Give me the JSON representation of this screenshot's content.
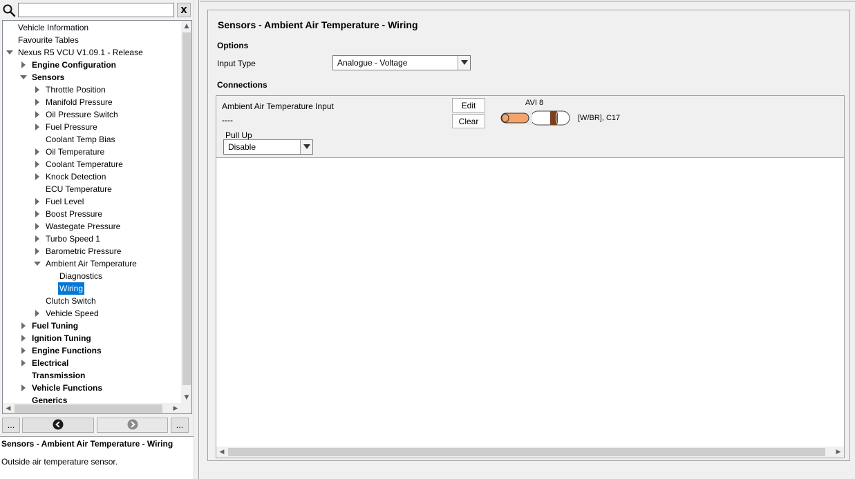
{
  "search": {
    "value": "",
    "placeholder": "",
    "clear_label": "X"
  },
  "tree": {
    "items": [
      {
        "label": "Vehicle Information",
        "depth": 0,
        "arrow": "none",
        "bold": false
      },
      {
        "label": "Favourite Tables",
        "depth": 0,
        "arrow": "none",
        "bold": false
      },
      {
        "label": "Nexus R5 VCU V1.09.1 - Release",
        "depth": 0,
        "arrow": "open",
        "bold": false
      },
      {
        "label": "Engine Configuration",
        "depth": 1,
        "arrow": "closed",
        "bold": true
      },
      {
        "label": "Sensors",
        "depth": 1,
        "arrow": "open",
        "bold": true
      },
      {
        "label": "Throttle Position",
        "depth": 2,
        "arrow": "closed",
        "bold": false
      },
      {
        "label": "Manifold Pressure",
        "depth": 2,
        "arrow": "closed",
        "bold": false
      },
      {
        "label": "Oil Pressure Switch",
        "depth": 2,
        "arrow": "closed",
        "bold": false
      },
      {
        "label": "Fuel Pressure",
        "depth": 2,
        "arrow": "closed",
        "bold": false
      },
      {
        "label": "Coolant Temp Bias",
        "depth": 2,
        "arrow": "none",
        "bold": false
      },
      {
        "label": "Oil Temperature",
        "depth": 2,
        "arrow": "closed",
        "bold": false
      },
      {
        "label": "Coolant Temperature",
        "depth": 2,
        "arrow": "closed",
        "bold": false
      },
      {
        "label": "Knock Detection",
        "depth": 2,
        "arrow": "closed",
        "bold": false
      },
      {
        "label": "ECU Temperature",
        "depth": 2,
        "arrow": "none",
        "bold": false
      },
      {
        "label": "Fuel Level",
        "depth": 2,
        "arrow": "closed",
        "bold": false
      },
      {
        "label": "Boost Pressure",
        "depth": 2,
        "arrow": "closed",
        "bold": false
      },
      {
        "label": "Wastegate Pressure",
        "depth": 2,
        "arrow": "closed",
        "bold": false
      },
      {
        "label": "Turbo Speed 1",
        "depth": 2,
        "arrow": "closed",
        "bold": false
      },
      {
        "label": "Barometric Pressure",
        "depth": 2,
        "arrow": "closed",
        "bold": false
      },
      {
        "label": "Ambient Air Temperature",
        "depth": 2,
        "arrow": "open",
        "bold": false
      },
      {
        "label": "Diagnostics",
        "depth": 3,
        "arrow": "none",
        "bold": false
      },
      {
        "label": "Wiring",
        "depth": 3,
        "arrow": "none",
        "bold": false,
        "selected": true
      },
      {
        "label": "Clutch Switch",
        "depth": 2,
        "arrow": "none",
        "bold": false
      },
      {
        "label": "Vehicle Speed",
        "depth": 2,
        "arrow": "closed",
        "bold": false
      },
      {
        "label": "Fuel Tuning",
        "depth": 1,
        "arrow": "closed",
        "bold": true
      },
      {
        "label": "Ignition Tuning",
        "depth": 1,
        "arrow": "closed",
        "bold": true
      },
      {
        "label": "Engine Functions",
        "depth": 1,
        "arrow": "closed",
        "bold": true
      },
      {
        "label": "Electrical",
        "depth": 1,
        "arrow": "closed",
        "bold": true
      },
      {
        "label": "Transmission",
        "depth": 1,
        "arrow": "none",
        "bold": true
      },
      {
        "label": "Vehicle Functions",
        "depth": 1,
        "arrow": "closed",
        "bold": true
      },
      {
        "label": "Generics",
        "depth": 1,
        "arrow": "none",
        "bold": true
      }
    ]
  },
  "nav": {
    "more_left_label": "...",
    "more_right_label": "...",
    "back_icon": "back-arrow-icon",
    "forward_icon": "forward-arrow-icon"
  },
  "description": {
    "title": "Sensors - Ambient Air Temperature - Wiring",
    "text": "Outside air temperature sensor."
  },
  "page": {
    "title": "Sensors - Ambient Air Temperature - Wiring",
    "options_heading": "Options",
    "input_type_label": "Input Type",
    "input_type_value": "Analogue - Voltage",
    "connections_heading": "Connections"
  },
  "connection": {
    "name": "Ambient Air Temperature Input",
    "value": "----",
    "pullup_label": "Pull Up",
    "pullup_value": "Disable",
    "edit_label": "Edit",
    "clear_label": "Clear",
    "pin": "AVI 8",
    "wire_info": "[W/BR], C17"
  },
  "colors": {
    "selection": "#0078d7",
    "wire_core": "#f4a36a",
    "wire_stripe": "#7b3f1d"
  }
}
